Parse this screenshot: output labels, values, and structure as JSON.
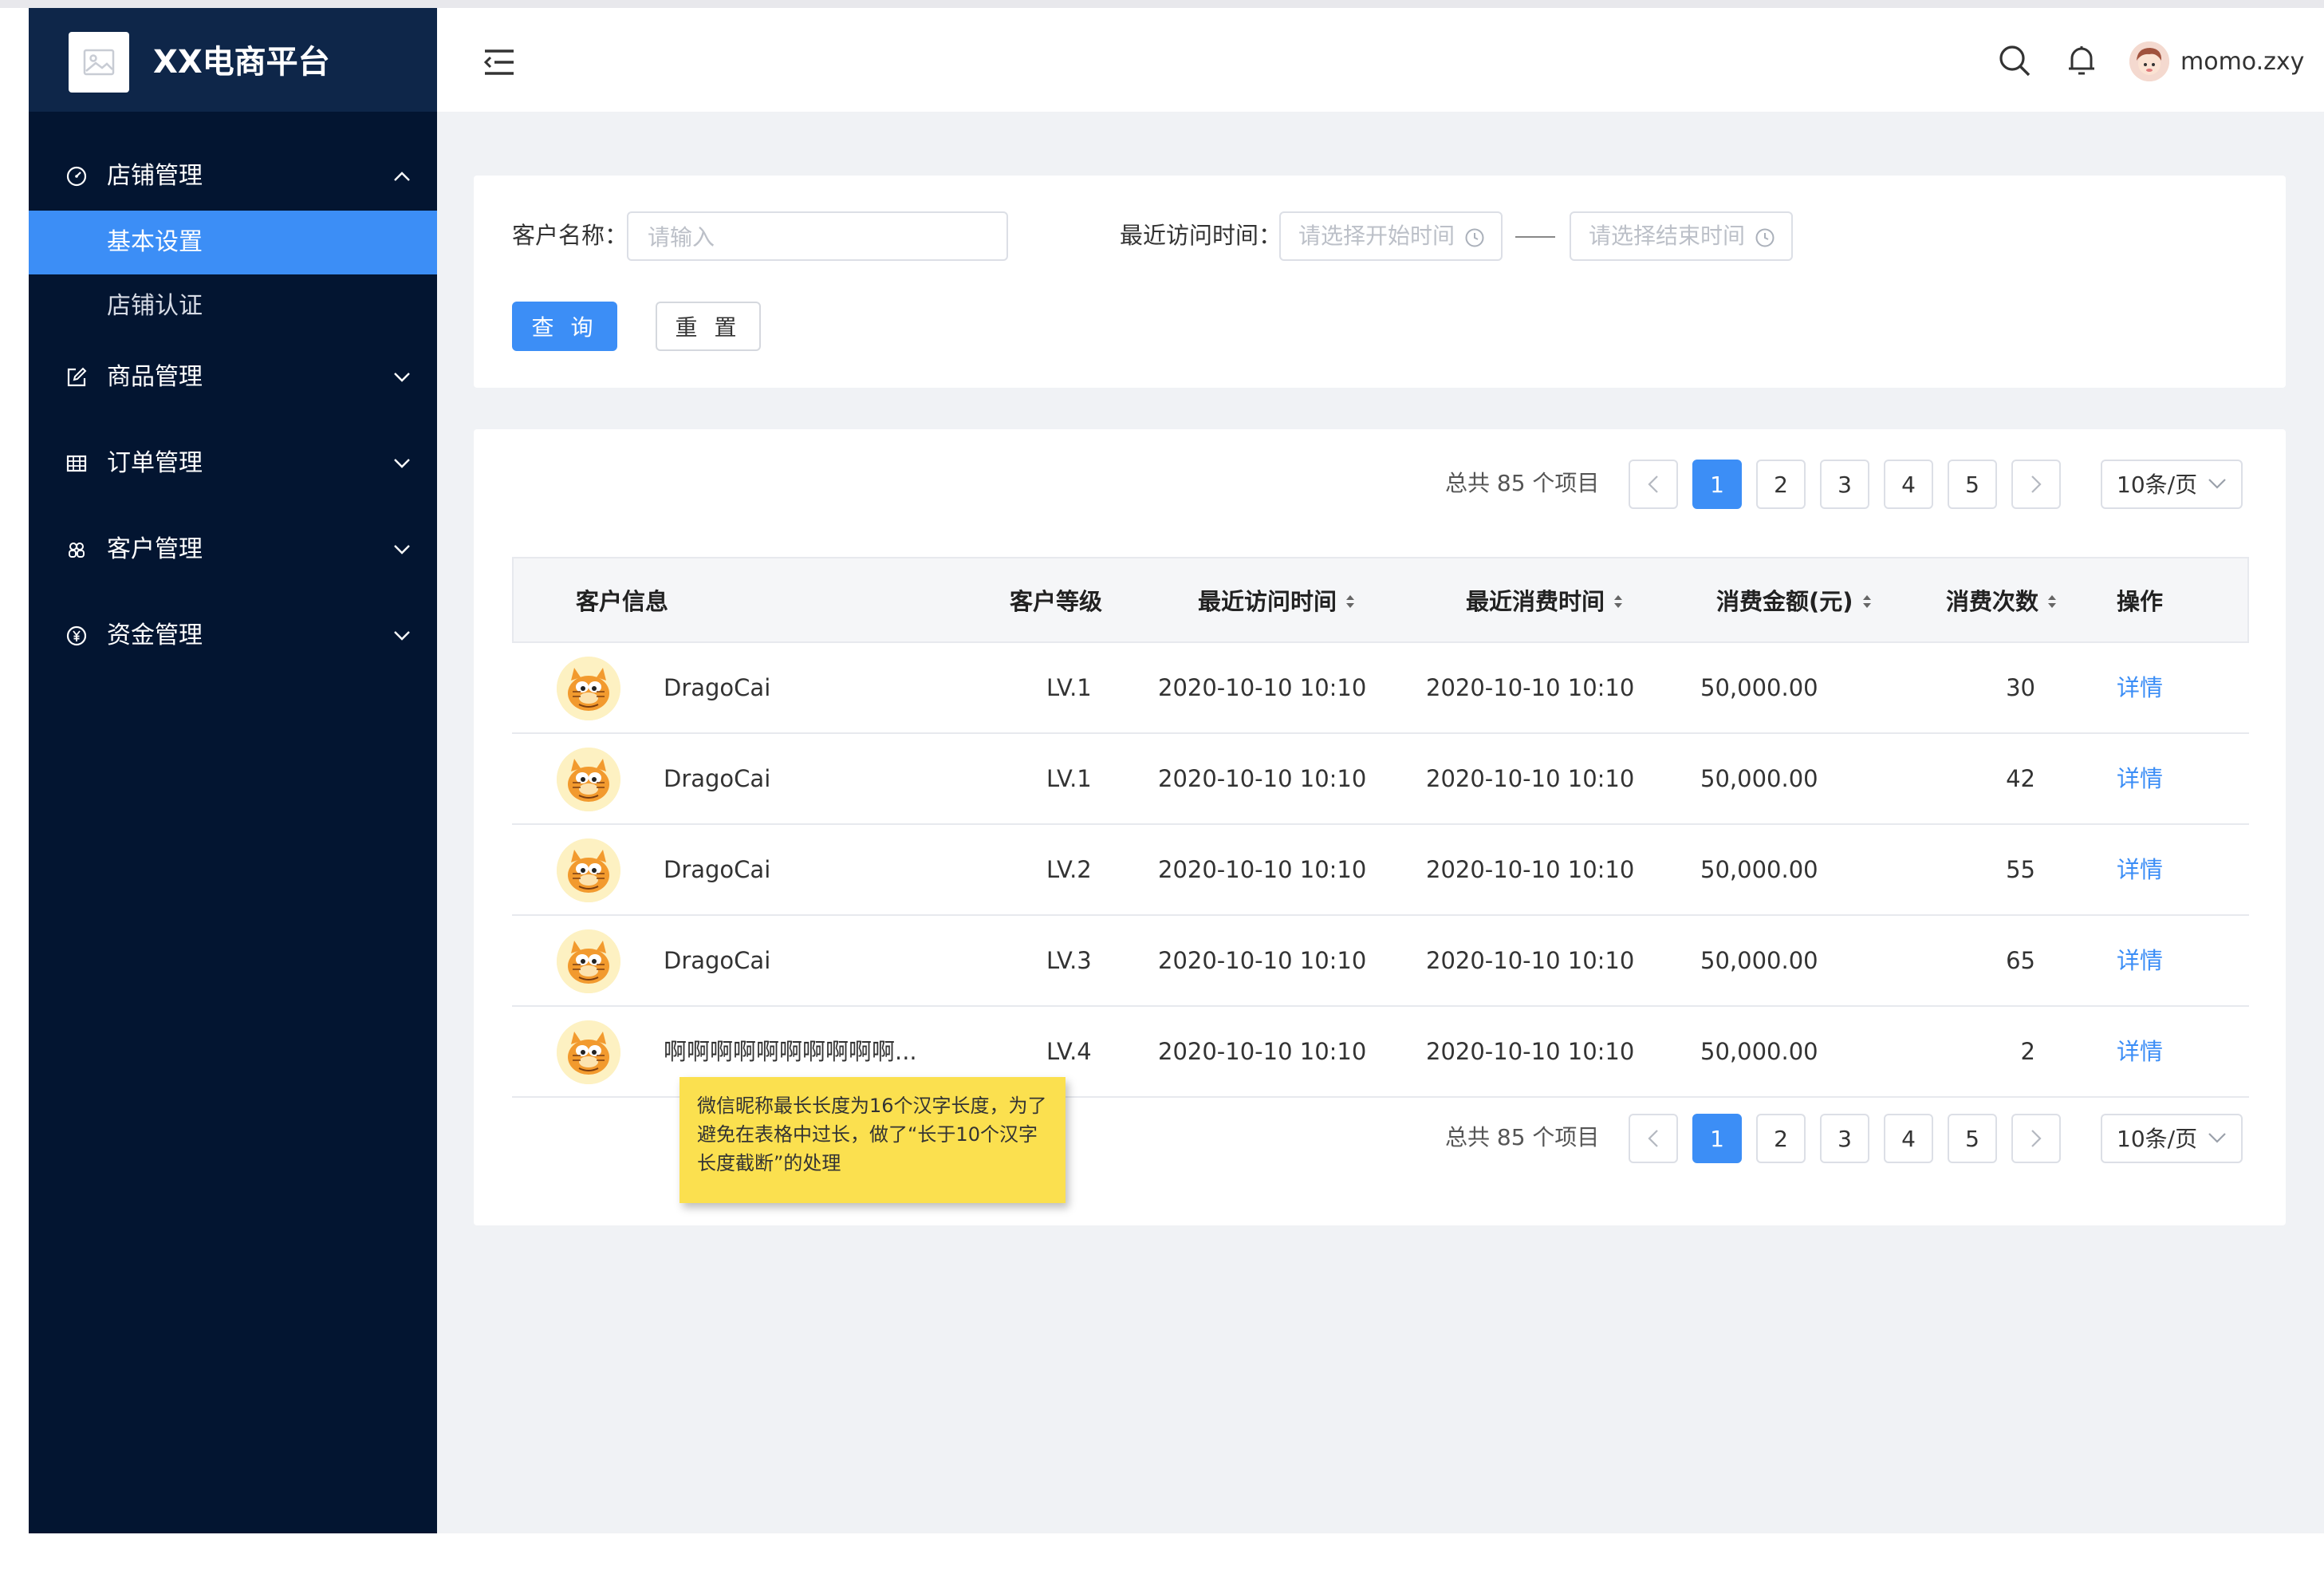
{
  "app": {
    "title": "XX电商平台"
  },
  "sidebar": {
    "groups": [
      {
        "label": "店铺管理",
        "icon": "dashboard-icon",
        "expanded": true,
        "items": [
          {
            "label": "基本设置",
            "active": true
          },
          {
            "label": "店铺认证",
            "active": false
          }
        ]
      },
      {
        "label": "商品管理",
        "icon": "edit-icon",
        "expanded": false
      },
      {
        "label": "订单管理",
        "icon": "table-icon",
        "expanded": false
      },
      {
        "label": "客户管理",
        "icon": "users-icon",
        "expanded": false
      },
      {
        "label": "资金管理",
        "icon": "yuan-icon",
        "expanded": false
      }
    ]
  },
  "header": {
    "username": "momo.zxy"
  },
  "filter": {
    "name_label": "客户名称：",
    "name_placeholder": "请输入",
    "time_label": "最近访问时间：",
    "start_placeholder": "请选择开始时间",
    "end_placeholder": "请选择结束时间",
    "query_label": "查 询",
    "reset_label": "重 置"
  },
  "pagination": {
    "total_text": "总共 85 个项目",
    "pages": [
      "1",
      "2",
      "3",
      "4",
      "5"
    ],
    "current": "1",
    "page_size": "10条/页"
  },
  "table": {
    "columns": [
      "客户信息",
      "客户等级",
      "最近访问时间",
      "最近消费时间",
      "消费金额(元)",
      "消费次数",
      "操作"
    ],
    "rows": [
      {
        "name": "DragoCai",
        "level": "LV.1",
        "visit": "2020-10-10 10:10",
        "consume": "2020-10-10 10:10",
        "amount": "50,000.00",
        "count": "30",
        "action": "详情"
      },
      {
        "name": "DragoCai",
        "level": "LV.1",
        "visit": "2020-10-10 10:10",
        "consume": "2020-10-10 10:10",
        "amount": "50,000.00",
        "count": "42",
        "action": "详情"
      },
      {
        "name": "DragoCai",
        "level": "LV.2",
        "visit": "2020-10-10 10:10",
        "consume": "2020-10-10 10:10",
        "amount": "50,000.00",
        "count": "55",
        "action": "详情"
      },
      {
        "name": "DragoCai",
        "level": "LV.3",
        "visit": "2020-10-10 10:10",
        "consume": "2020-10-10 10:10",
        "amount": "50,000.00",
        "count": "65",
        "action": "详情"
      },
      {
        "name": "啊啊啊啊啊啊啊啊啊啊...",
        "level": "LV.4",
        "visit": "2020-10-10 10:10",
        "consume": "2020-10-10 10:10",
        "amount": "50,000.00",
        "count": "2",
        "action": "详情"
      }
    ]
  },
  "note": {
    "text": "微信昵称最长长度为16个汉字长度，为了避免在表格中过长，做了“长于10个汉字长度截断”的处理"
  },
  "colors": {
    "sidebar_bg": "#031531",
    "brand_bg": "#0e2649",
    "accent": "#3c8ef6",
    "content_bg": "#f0f2f5",
    "note_bg": "#fbe04f"
  }
}
